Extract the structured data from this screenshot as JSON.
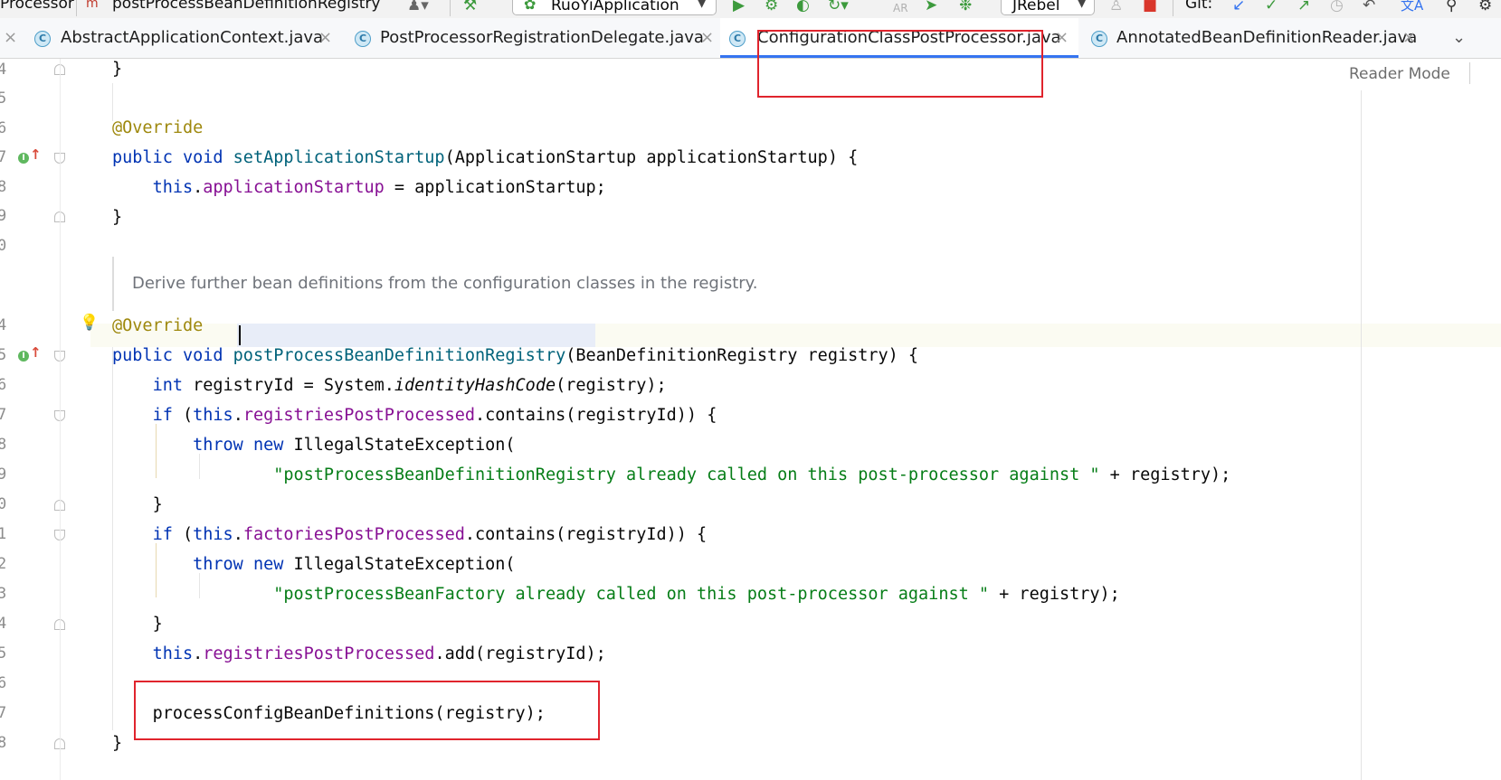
{
  "toolbar": {
    "breadcrumb_class": "Processor",
    "breadcrumb_method_icon": "m",
    "breadcrumb_method": "postProcessBeanDefinitionRegistry",
    "run_config": "RuoYiApplication",
    "jrebel": "JRebel",
    "git_label": "Git:"
  },
  "tabs": [
    {
      "label": "AbstractApplicationContext.java",
      "active": false
    },
    {
      "label": "PostProcessorRegistrationDelegate.java",
      "active": false
    },
    {
      "label": "ConfigurationClassPostProcessor.java",
      "active": true
    },
    {
      "label": "AnnotatedBeanDefinitionReader.java",
      "active": false
    }
  ],
  "tab_icon_letter": "C",
  "tab_close_glyph": "×",
  "editor": {
    "reader_mode": "Reader Mode",
    "doc_comment": "Derive further bean definitions from the configuration classes in the registry.",
    "line_numbers": [
      "4",
      "5",
      "6",
      "7",
      "8",
      "9",
      "0",
      "4",
      "5",
      "6",
      "7",
      "8",
      "9",
      "0",
      "1",
      "2",
      "3",
      "4",
      "5",
      "6",
      "7",
      "8"
    ],
    "code": {
      "l1": "}",
      "l3_ann": "@Override",
      "l4_kw1": "public",
      "l4_kw2": "void",
      "l4_name": "setApplicationStartup",
      "l4_rest": "(ApplicationStartup applicationStartup) {",
      "l5_this": "this",
      "l5_field": "applicationStartup",
      "l5_rest": " = applicationStartup;",
      "l6": "}",
      "l8_ann": "@Override",
      "l9_kw1": "public",
      "l9_kw2": "void",
      "l9_name": "postProcessBeanDefinitionRegistry",
      "l9_rest": "(BeanDefinitionRegistry registry) {",
      "l10_kw": "int",
      "l10_a": " registryId = System.",
      "l10_call": "identityHashCode",
      "l10_b": "(registry);",
      "l11_kw": "if",
      "l11_a": " (",
      "l11_this": "this",
      "l11_field": "registriesPostProcessed",
      "l11_b": ".contains(registryId)) {",
      "l12_kw1": "throw",
      "l12_kw2": "new",
      "l12_rest": " IllegalStateException(",
      "l13_str": "\"postProcessBeanDefinitionRegistry already called on this post-processor against \"",
      "l13_rest": " + registry);",
      "l14": "}",
      "l15_kw": "if",
      "l15_a": " (",
      "l15_this": "this",
      "l15_field": "factoriesPostProcessed",
      "l15_b": ".contains(registryId)) {",
      "l16_kw1": "throw",
      "l16_kw2": "new",
      "l16_rest": " IllegalStateException(",
      "l17_str": "\"postProcessBeanFactory already called on this post-processor against \"",
      "l17_rest": " + registry);",
      "l18": "}",
      "l19_this": "this",
      "l19_field": "registriesPostProcessed",
      "l19_rest": ".add(registryId);",
      "l21": "processConfigBeanDefinitions(registry);",
      "l22": "}"
    }
  },
  "colors": {
    "keyword": "#0033b3",
    "annotation": "#9e880d",
    "field": "#871094",
    "string": "#067d17",
    "method": "#00627a",
    "highlight_box": "#e0242d",
    "active_tab_underline": "#3574f0"
  }
}
